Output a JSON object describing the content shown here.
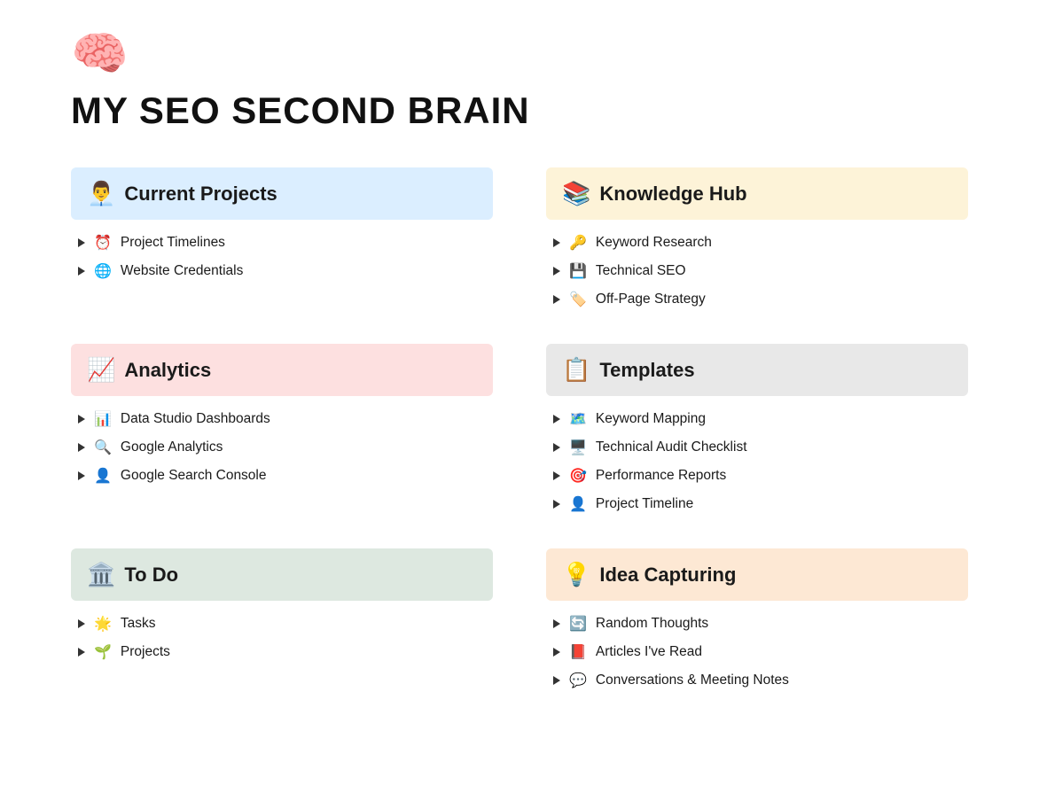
{
  "page": {
    "brain_emoji": "🧠",
    "title": "MY SEO SECOND BRAIN"
  },
  "cards": [
    {
      "id": "current-projects",
      "icon": "👨‍💼",
      "title": "Current Projects",
      "bg": "bg-blue",
      "items": [
        {
          "icon": "⏰",
          "label": "Project Timelines"
        },
        {
          "icon": "🌐",
          "label": "Website Credentials"
        }
      ]
    },
    {
      "id": "knowledge-hub",
      "icon": "📚",
      "title": "Knowledge Hub",
      "bg": "bg-yellow",
      "items": [
        {
          "icon": "🔑",
          "label": "Keyword Research"
        },
        {
          "icon": "💾",
          "label": "Technical SEO"
        },
        {
          "icon": "🏷️",
          "label": "Off-Page Strategy"
        }
      ]
    },
    {
      "id": "analytics",
      "icon": "📈",
      "title": "Analytics",
      "bg": "bg-pink",
      "items": [
        {
          "icon": "📊",
          "label": "Data Studio Dashboards"
        },
        {
          "icon": "🔍",
          "label": "Google Analytics"
        },
        {
          "icon": "👤",
          "label": "Google Search Console"
        }
      ]
    },
    {
      "id": "templates",
      "icon": "📋",
      "title": "Templates",
      "bg": "bg-gray",
      "items": [
        {
          "icon": "🗺️",
          "label": "Keyword Mapping"
        },
        {
          "icon": "🖥️",
          "label": "Technical Audit Checklist"
        },
        {
          "icon": "🎯",
          "label": "Performance Reports"
        },
        {
          "icon": "👤",
          "label": "Project Timeline"
        }
      ]
    },
    {
      "id": "todo",
      "icon": "🏛️",
      "title": "To Do",
      "bg": "bg-sage",
      "items": [
        {
          "icon": "🌟",
          "label": "Tasks"
        },
        {
          "icon": "🌱",
          "label": "Projects"
        }
      ]
    },
    {
      "id": "idea-capturing",
      "icon": "💡",
      "title": "Idea Capturing",
      "bg": "bg-peach",
      "items": [
        {
          "icon": "🔄",
          "label": "Random Thoughts"
        },
        {
          "icon": "📕",
          "label": "Articles I've Read"
        },
        {
          "icon": "💬",
          "label": "Conversations & Meeting Notes"
        }
      ]
    }
  ]
}
